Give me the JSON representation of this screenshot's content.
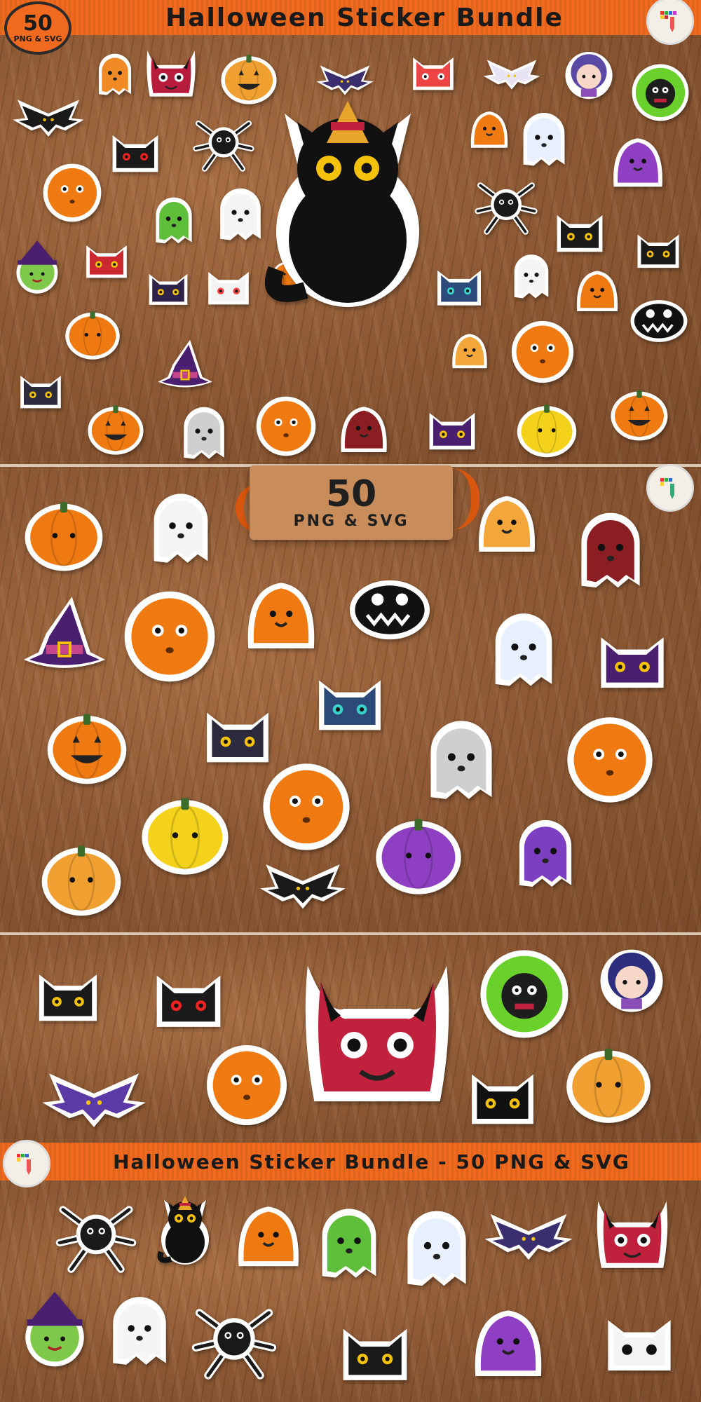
{
  "header": {
    "title": "Halloween Sticker Bundle",
    "badge_count": "50",
    "badge_format": "PNG & SVG"
  },
  "middle_badge": {
    "count": "50",
    "format": "PNG & SVG"
  },
  "footer_banner": {
    "text": "Halloween Sticker Bundle - 50 PNG & SVG"
  },
  "colors": {
    "banner_orange": "#ef6a1e",
    "wood": "#8e5a35",
    "sticker_border": "#ffffff",
    "pumpkin": "#f07a12",
    "cat_black": "#111111",
    "ghost_white": "#f5f5f5",
    "witch_purple": "#4b1f6f",
    "devil_red": "#b81c3c"
  },
  "icons": {
    "logo": "pencil-pixel-logo-icon"
  }
}
